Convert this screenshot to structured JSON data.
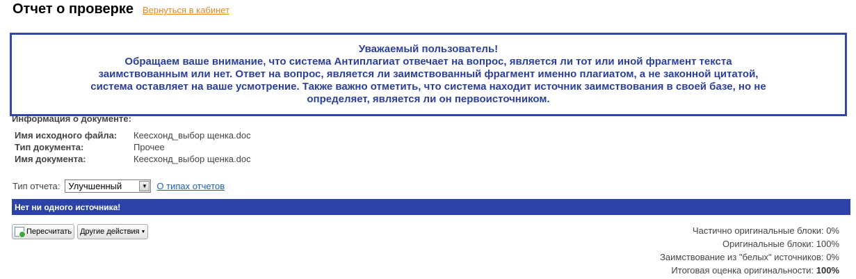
{
  "header": {
    "title": "Отчет о проверке",
    "back_link": "Вернуться в кабинет"
  },
  "notice": {
    "lines": [
      "Уважаемый пользователь!",
      "Обращаем ваше внимание, что система Антиплагиат отвечает на вопрос, является ли тот или иной фрагмент текста",
      "заимствованным или нет. Ответ на вопрос, является ли заимствованный фрагмент именно плагиатом, а не законной цитатой,",
      "система оставляет на ваше усмотрение. Также важно отметить, что система находит источник заимствования в своей базе, но не",
      "определяет, является ли он первоисточником."
    ]
  },
  "doc_info": {
    "title": "Информация о документе:",
    "rows": [
      {
        "label": "Имя исходного файла:",
        "value": "Кеесхонд_выбор щенка.doc"
      },
      {
        "label": "Тип документа:",
        "value": "Прочее"
      },
      {
        "label": "Имя документа:",
        "value": "Кеесхонд_выбор щенка.doc"
      }
    ]
  },
  "report": {
    "label": "Тип отчета:",
    "selected": "Улучшенный",
    "types_link": "О типах отчетов"
  },
  "no_sources": "Нет ни одного источника!",
  "buttons": {
    "recalc": "Пересчитать",
    "other": "Другие действия"
  },
  "stats": {
    "partial": {
      "label": "Частично оригинальные блоки:",
      "value": "0%"
    },
    "original": {
      "label": "Оригинальные блоки:",
      "value": "100%"
    },
    "white": {
      "label": "Заимствование из \"белых\" источников:",
      "value": "0%"
    },
    "total": {
      "label": "Итоговая оценка оригинальности:",
      "value": "100%"
    }
  }
}
